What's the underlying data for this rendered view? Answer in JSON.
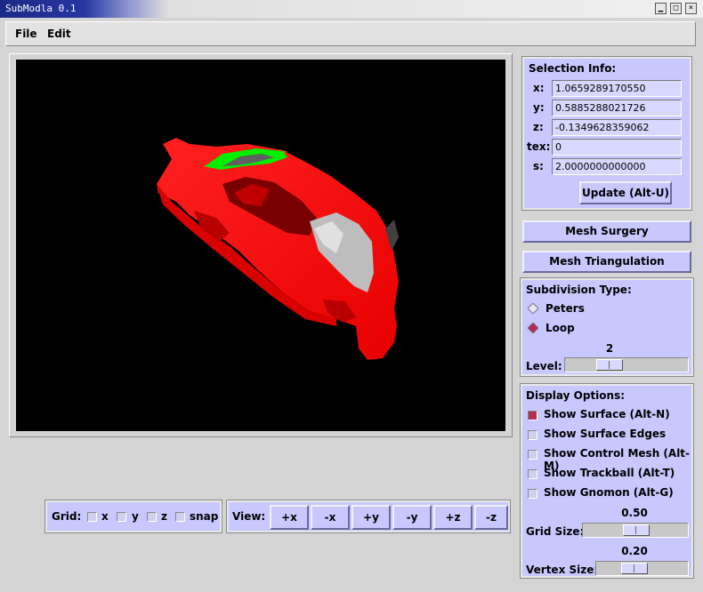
{
  "window": {
    "title": "SubModla 0.1",
    "minimize_glyph": "▁",
    "maximize_glyph": "□",
    "close_glyph": "×"
  },
  "menu": {
    "file": "File",
    "edit": "Edit"
  },
  "selection_info": {
    "heading": "Selection Info:",
    "x_label": "x:",
    "x_value": "1.0659289170550",
    "y_label": "y:",
    "y_value": "0.5885288021726",
    "z_label": "z:",
    "z_value": "-0.1349628359062",
    "tex_label": "tex:",
    "tex_value": "0",
    "s_label": "s:",
    "s_value": "2.0000000000000",
    "update_button": "Update (Alt-U)"
  },
  "mesh_surgery_button": "Mesh Surgery",
  "mesh_triangulation_button": "Mesh Triangulation",
  "subdivision": {
    "heading": "Subdivision Type:",
    "peters": "Peters",
    "loop": "Loop",
    "selected": "Loop",
    "level_label": "Level:",
    "level_value": "2"
  },
  "display_options": {
    "heading": "Display Options:",
    "show_surface": "Show Surface (Alt-N)",
    "show_surface_edges": "Show Surface Edges",
    "show_control_mesh": "Show Control Mesh (Alt-M)",
    "show_trackball": "Show Trackball (Alt-T)",
    "show_gnomon": "Show Gnomon (Alt-G)",
    "show_surface_checked": true,
    "grid_size_value": "0.50",
    "grid_size_label": "Grid Size:",
    "vertex_size_value": "0.20",
    "vertex_size_label": "Vertex Size:"
  },
  "grid": {
    "label": "Grid:",
    "x": "x",
    "y": "y",
    "z": "z",
    "snap": "snap"
  },
  "view": {
    "label": "View:",
    "buttons": [
      "+x",
      "-x",
      "+y",
      "-y",
      "+z",
      "-z"
    ]
  },
  "colors": {
    "panel": "#c8c8ff",
    "model": "#ff0000",
    "selection": "#00ee00",
    "viewport_bg": "#000000"
  }
}
